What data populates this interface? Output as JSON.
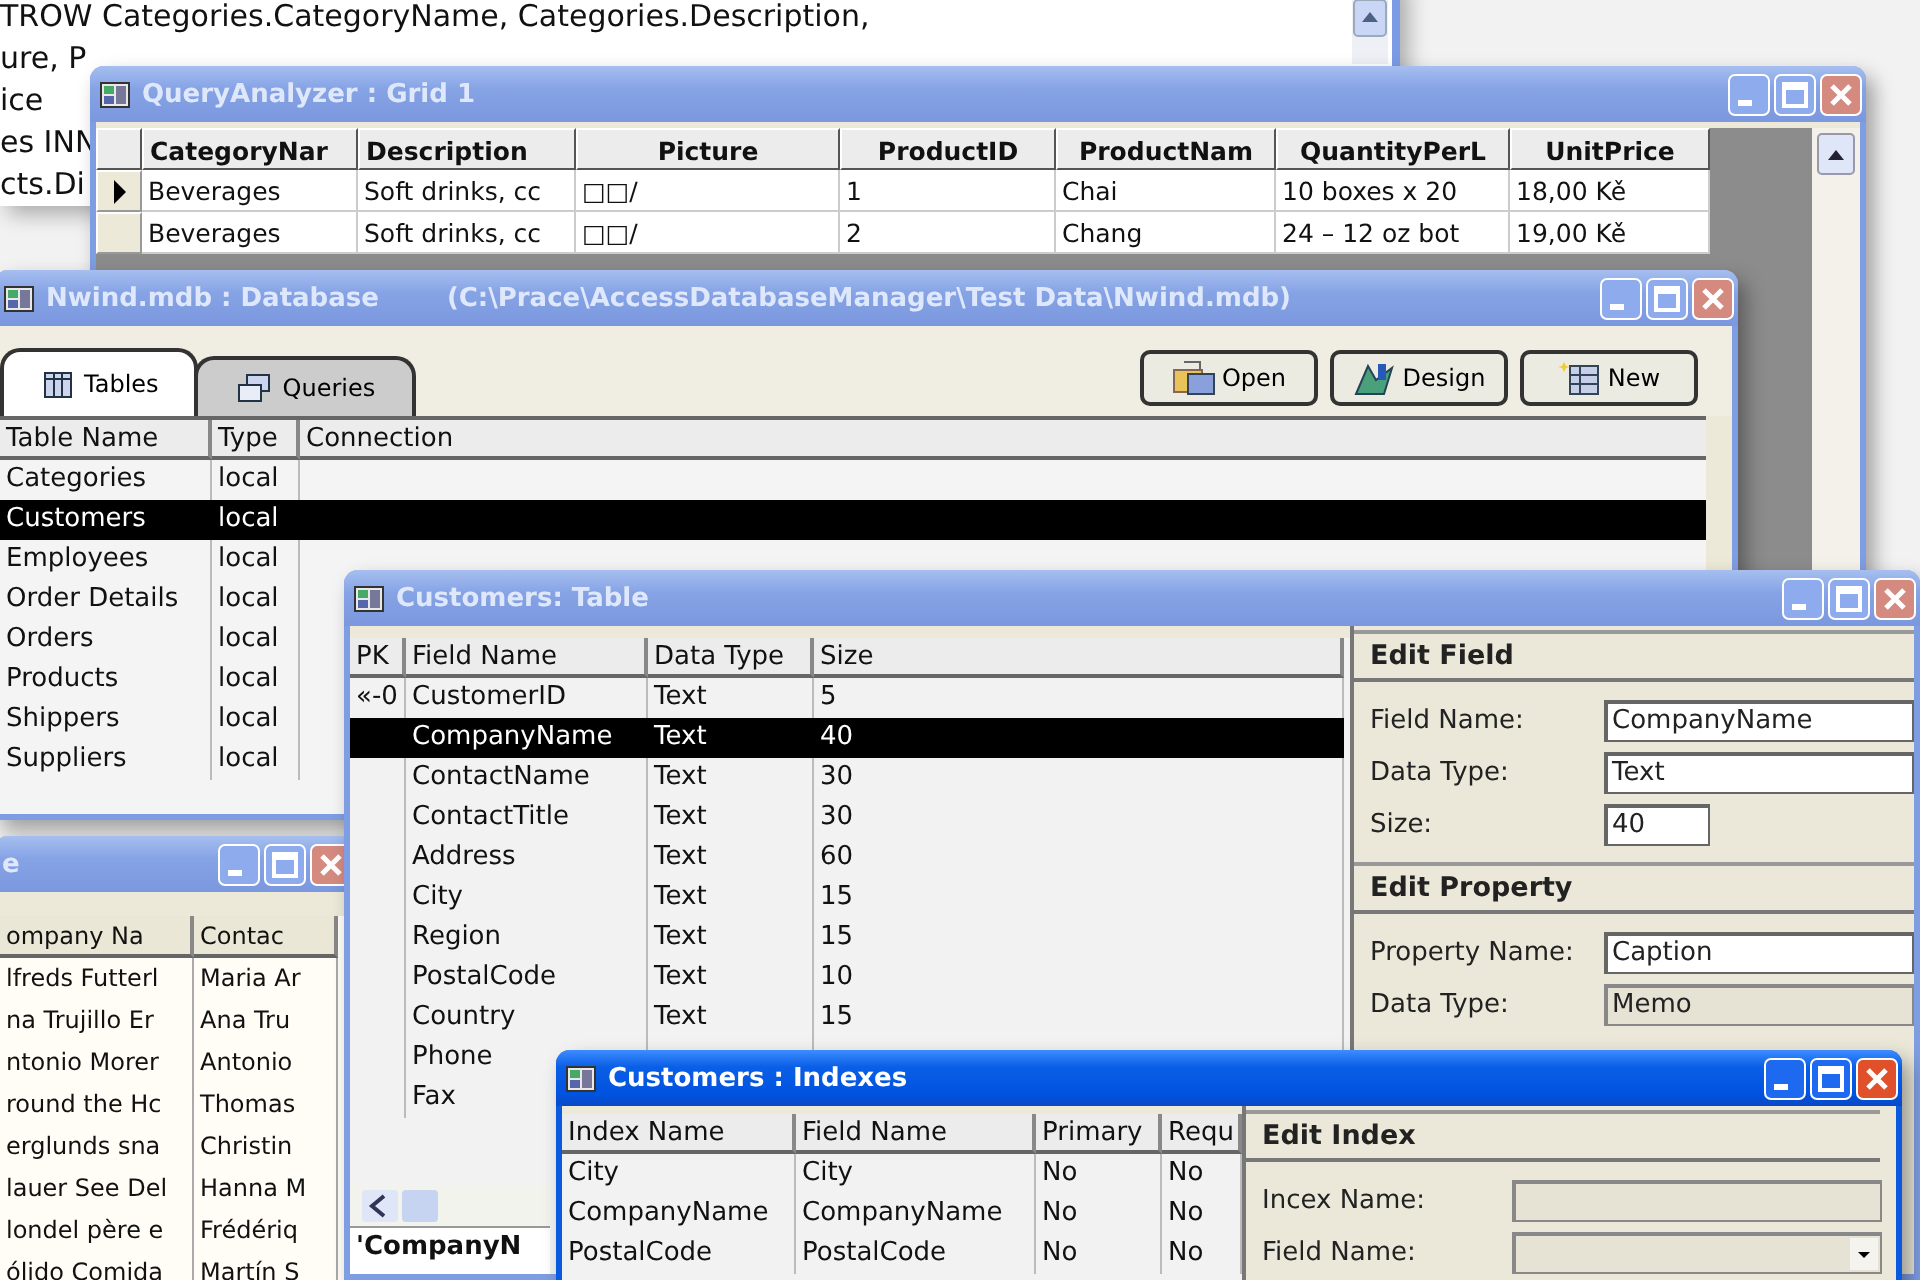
{
  "sql_editor": {
    "lines": [
      "TROW Categories.CategoryName, Categories.Description,",
      "ure, P",
      "ice",
      "es INN",
      "cts.Di"
    ]
  },
  "query_grid": {
    "title": "QueryAnalyzer : Grid 1",
    "active": false,
    "columns": [
      "CategoryNar",
      "Description",
      "Picture",
      "ProductID",
      "ProductNam",
      "QuantityPerL",
      "UnitPrice"
    ],
    "rows": [
      {
        "current": true,
        "cells": [
          "Beverages",
          "Soft drinks, cc",
          "□□/",
          "1",
          "Chai",
          "10 boxes x 20",
          "18,00 Kě"
        ]
      },
      {
        "current": false,
        "cells": [
          "Beverages",
          "Soft drinks, cc",
          "□□/",
          "2",
          "Chang",
          "24 – 12 oz bot",
          "19,00 Kě"
        ]
      }
    ]
  },
  "database_window": {
    "title": "Nwind.mdb : Database",
    "path": "(C:\\Prace\\AccessDatabaseManager\\Test Data\\Nwind.mdb)",
    "active": false,
    "tabs": [
      {
        "label": "Tables",
        "selected": true
      },
      {
        "label": "Queries",
        "selected": false
      }
    ],
    "buttons": [
      "Open",
      "Design",
      "New"
    ],
    "columns": [
      "Table Name",
      "Type",
      "Connection"
    ],
    "rows": [
      {
        "cells": [
          "Categories",
          "local"
        ],
        "selected": false
      },
      {
        "cells": [
          "Customers",
          "local"
        ],
        "selected": true
      },
      {
        "cells": [
          "Employees",
          "local"
        ],
        "selected": false
      },
      {
        "cells": [
          "Order Details",
          "local"
        ],
        "selected": false
      },
      {
        "cells": [
          "Orders",
          "local"
        ],
        "selected": false
      },
      {
        "cells": [
          "Products",
          "local"
        ],
        "selected": false
      },
      {
        "cells": [
          "Shippers",
          "local"
        ],
        "selected": false
      },
      {
        "cells": [
          "Suppliers",
          "local"
        ],
        "selected": false
      }
    ]
  },
  "datasheet_window": {
    "title": "e",
    "active": false,
    "columns": [
      "ompany Na",
      "Contac"
    ],
    "rows": [
      {
        "cells": [
          "lfreds Futterl",
          "Maria Ar"
        ]
      },
      {
        "cells": [
          "na Trujillo Er",
          "Ana Tru"
        ]
      },
      {
        "cells": [
          "ntonio Morer",
          "Antonio"
        ]
      },
      {
        "cells": [
          "round the Hc",
          "Thomas"
        ]
      },
      {
        "cells": [
          "erglunds sna",
          "Christin"
        ]
      },
      {
        "cells": [
          "lauer See Del",
          "Hanna M"
        ]
      },
      {
        "cells": [
          "londel père e",
          "Frédériq"
        ]
      },
      {
        "cells": [
          "ólido Comida",
          "Martín S"
        ]
      }
    ]
  },
  "table_window": {
    "title": "Customers: Table",
    "active": false,
    "columns": [
      "PK",
      "Field Name",
      "Data Type",
      "Size"
    ],
    "rows": [
      {
        "pk": "«-0",
        "field_name": "CustomerID",
        "data_type": "Text",
        "size": "5",
        "selected": false
      },
      {
        "field_name": "CompanyName",
        "data_type": "Text",
        "size": "40",
        "selected": true
      },
      {
        "field_name": "ContactName",
        "data_type": "Text",
        "size": "30",
        "selected": false
      },
      {
        "field_name": "ContactTitle",
        "data_type": "Text",
        "size": "30",
        "selected": false
      },
      {
        "field_name": "Address",
        "data_type": "Text",
        "size": "60",
        "selected": false
      },
      {
        "field_name": "City",
        "data_type": "Text",
        "size": "15",
        "selected": false
      },
      {
        "field_name": "Region",
        "data_type": "Text",
        "size": "15",
        "selected": false
      },
      {
        "field_name": "PostalCode",
        "data_type": "Text",
        "size": "10",
        "selected": false
      },
      {
        "field_name": "Country",
        "data_type": "Text",
        "size": "15",
        "selected": false
      },
      {
        "field_name": "Phone",
        "selected": false
      },
      {
        "field_name": "Fax",
        "selected": false
      }
    ],
    "footer": "'CompanyN",
    "edit_field": {
      "heading": "Edit Field",
      "fields": [
        {
          "label": "Field Name:",
          "value": "CompanyName",
          "kind": "text"
        },
        {
          "label": "Data Type:",
          "value": "Text",
          "kind": "text"
        },
        {
          "label": "Size:",
          "value": "40",
          "kind": "short"
        }
      ]
    },
    "edit_property": {
      "heading": "Edit Property",
      "fields": [
        {
          "label": "Property Name:",
          "value": "Caption",
          "kind": "text"
        },
        {
          "label": "Data Type:",
          "value": "Memo",
          "kind": "readonly"
        }
      ]
    }
  },
  "indexes_window": {
    "title": "Customers : Indexes",
    "active": true,
    "columns": [
      "Index Name",
      "Field Name",
      "Primary",
      "Requ"
    ],
    "rows": [
      {
        "cells": [
          "City",
          "City",
          "No",
          "No"
        ]
      },
      {
        "cells": [
          "CompanyName",
          "CompanyName",
          "No",
          "No"
        ]
      },
      {
        "cells": [
          "PostalCode",
          "PostalCode",
          "No",
          "No"
        ]
      }
    ],
    "edit_index": {
      "heading": "Edit Index",
      "fields": [
        {
          "label": "Incex Name:",
          "kind": "readonly"
        },
        {
          "label": "Field Name:",
          "kind": "dropdown"
        }
      ]
    }
  }
}
